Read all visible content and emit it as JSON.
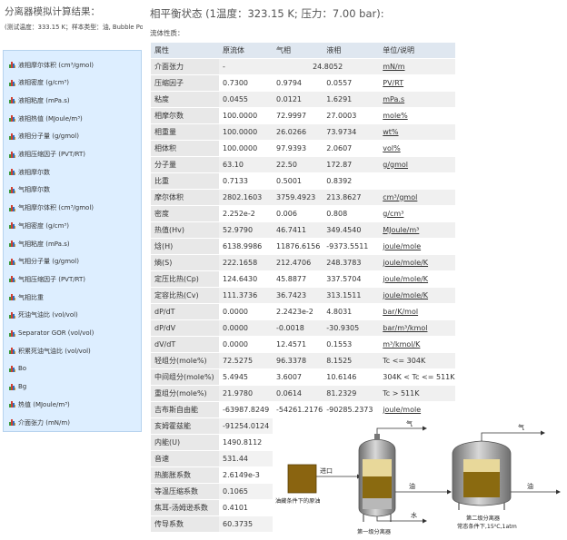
{
  "left_panel": {
    "title": "分离器模拟计算结果：",
    "subinfo": "(测试温度：333.15 K；样本类型：油, Bubble Po",
    "items": [
      {
        "label": "液相摩尔体积 (cm³/gmol)"
      },
      {
        "label": "液相密度 (g/cm³)"
      },
      {
        "label": "液相粘度 (mPa.s)"
      },
      {
        "label": "液相热值 (MJoule/m³)"
      },
      {
        "label": "液相分子量 (g/gmol)"
      },
      {
        "label": "液相压缩因子 (PVT/RT)"
      },
      {
        "label": "液相摩尔数"
      },
      {
        "label": "气相摩尔数"
      },
      {
        "label": "气相摩尔体积 (cm³/gmol)"
      },
      {
        "label": "气相密度 (g/cm³)"
      },
      {
        "label": "气相粘度 (mPa.s)"
      },
      {
        "label": "气相分子量 (g/gmol)"
      },
      {
        "label": "气相压缩因子 (PVT/RT)"
      },
      {
        "label": "气相比重"
      },
      {
        "label": "死油气油比 (vol/vol)"
      },
      {
        "label": "Separator GOR (vol/vol)"
      },
      {
        "label": "积累死油气油比 (vol/vol)"
      },
      {
        "label": "Bo"
      },
      {
        "label": "Bg"
      },
      {
        "label": "热值 (MJoule/m³)"
      },
      {
        "label": "介面张力 (mN/m)"
      }
    ]
  },
  "header": {
    "title": "相平衡状态 (1温度：323.15 K; 压力：7.00 bar):",
    "subtitle": "流体性质："
  },
  "table": {
    "columns": [
      "属性",
      "原流体",
      "气相",
      "液相",
      "单位/说明"
    ],
    "rows": [
      [
        "介面张力",
        "-",
        "",
        "24.8052",
        "mN/m"
      ],
      [
        "压缩因子",
        "0.7300",
        "0.9794",
        "0.0557",
        "PV/RT"
      ],
      [
        "粘度",
        "0.0455",
        "0.0121",
        "1.6291",
        "mPa.s"
      ],
      [
        "相摩尔数",
        "100.0000",
        "72.9997",
        "27.0003",
        "mole%"
      ],
      [
        "相重量",
        "100.0000",
        "26.0266",
        "73.9734",
        "wt%"
      ],
      [
        "相体积",
        "100.0000",
        "97.9393",
        "2.0607",
        "vol%"
      ],
      [
        "分子量",
        "63.10",
        "22.50",
        "172.87",
        "g/gmol"
      ],
      [
        "比重",
        "0.7133",
        "0.5001",
        "0.8392",
        ""
      ],
      [
        "摩尔体积",
        "2802.1603",
        "3759.4923",
        "213.8627",
        "cm³/gmol"
      ],
      [
        "密度",
        "2.252e-2",
        "0.006",
        "0.808",
        "g/cm³"
      ],
      [
        "热值(Hv)",
        "52.9790",
        "46.7411",
        "349.4540",
        "MJoule/m³"
      ],
      [
        "焓(H)",
        "6138.9986",
        "11876.6156",
        "-9373.5511",
        "joule/mole"
      ],
      [
        "熵(S)",
        "222.1658",
        "212.4706",
        "248.3783",
        "joule/mole/K"
      ],
      [
        "定压比热(Cp)",
        "124.6430",
        "45.8877",
        "337.5704",
        "joule/mole/K"
      ],
      [
        "定容比热(Cv)",
        "111.3736",
        "36.7423",
        "313.1511",
        "joule/mole/K"
      ],
      [
        "dP/dT",
        "0.0000",
        "2.2423e-2",
        "4.8031",
        "bar/K/mol"
      ],
      [
        "dP/dV",
        "0.0000",
        "-0.0018",
        "-30.9305",
        "bar/m³/kmol"
      ],
      [
        "dV/dT",
        "0.0000",
        "12.4571",
        "0.1553",
        "m³/kmol/K"
      ],
      [
        "轻组分(mole%)",
        "72.5275",
        "96.3378",
        "8.1525",
        "Tc <= 304K"
      ],
      [
        "中间组分(mole%)",
        "5.4945",
        "3.6007",
        "10.6146",
        "304K < Tc <= 511K"
      ],
      [
        "重组分(mole%)",
        "21.9780",
        "0.0614",
        "81.2329",
        "Tc > 511K"
      ],
      [
        "吉布斯自由能",
        "-63987.8249",
        "-54261.2176",
        "-90285.2373",
        "joule/mole"
      ]
    ],
    "lower_rows": [
      [
        "亥姆霍兹能",
        "-91254.0124"
      ],
      [
        "内能(U)",
        "1490.8112"
      ],
      [
        "音速",
        "531.44"
      ],
      [
        "热膨胀系数",
        "2.6149e-3"
      ],
      [
        "等温压缩系数",
        "0.1065"
      ],
      [
        "焦耳-汤姆逊系数",
        "0.4101"
      ],
      [
        "传导系数",
        "60.3735"
      ]
    ]
  },
  "diagram": {
    "inlet_label": "进口",
    "feed_caption": "油藏条件下的原油",
    "gas_label_1": "气",
    "oil_label_1": "油",
    "water_label": "水",
    "gas_label_2": "气",
    "oil_label_2": "油",
    "stage1_caption": "第一级分离器",
    "stage2_caption_1": "第二级分离器",
    "stage2_caption_2": "常态条件下,15⁰C,1atm",
    "colors": {
      "oil": "#8a6a10",
      "gas_zone": "#e8d89a",
      "vessel": "#9a9a9a",
      "feed": "#8a6410"
    }
  }
}
